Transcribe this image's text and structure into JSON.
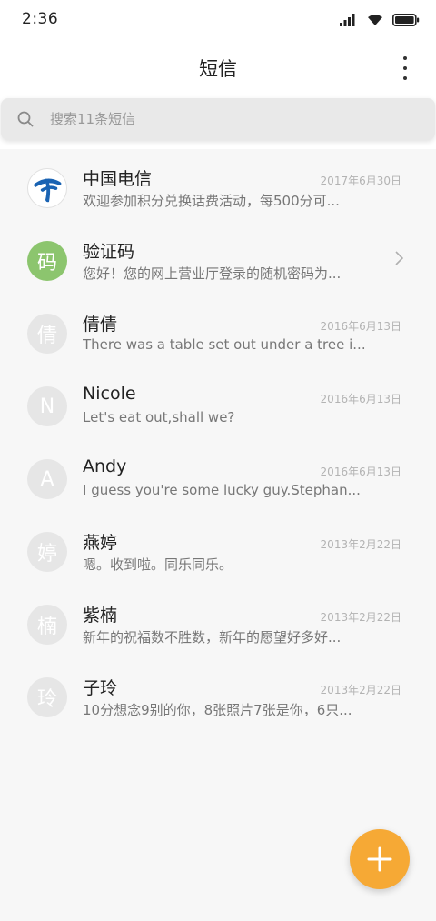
{
  "status_bar": {
    "time": "2:36",
    "icons": [
      "signal-icon",
      "wifi-icon",
      "battery-icon"
    ]
  },
  "header": {
    "title": "短信",
    "menu_icon": "more-vertical-icon"
  },
  "search": {
    "placeholder": "搜索11条短信",
    "icon": "search-icon"
  },
  "messages": [
    {
      "avatar": "",
      "avatar_type": "logo",
      "name": "中国电信",
      "date": "2017年6月30日",
      "preview": "欢迎参加积分兑换话费活动，每500分可..."
    },
    {
      "avatar": "码",
      "avatar_type": "green",
      "name": "验证码",
      "date": "",
      "preview": "您好！您的网上营业厅登录的随机密码为..."
    },
    {
      "avatar": "倩",
      "avatar_type": "default",
      "name": "倩倩",
      "date": "2016年6月13日",
      "preview": "There was a table set out under a tree i..."
    },
    {
      "avatar": "N",
      "avatar_type": "default",
      "name": "Nicole",
      "date": "2016年6月13日",
      "preview": "Let's eat out,shall we?"
    },
    {
      "avatar": "A",
      "avatar_type": "default",
      "name": "Andy",
      "date": "2016年6月13日",
      "preview": "I guess you're some lucky guy.Stephan..."
    },
    {
      "avatar": "婷",
      "avatar_type": "default",
      "name": "燕婷",
      "date": "2013年2月22日",
      "preview": "嗯。收到啦。同乐同乐。"
    },
    {
      "avatar": "楠",
      "avatar_type": "default",
      "name": "紫楠",
      "date": "2013年2月22日",
      "preview": "新年的祝福数不胜数，新年的愿望好多好..."
    },
    {
      "avatar": "玲",
      "avatar_type": "default",
      "name": "子玲",
      "date": "2013年2月22日",
      "preview": "10分想念9别的你，8张照片7张是你，6只..."
    }
  ],
  "fab": {
    "icon": "plus-icon"
  },
  "colors": {
    "accent": "#f6a935",
    "avatar_green": "#8cc56e",
    "avatar_default": "#e6e6e6",
    "telecom_blue": "#1a63b3"
  }
}
